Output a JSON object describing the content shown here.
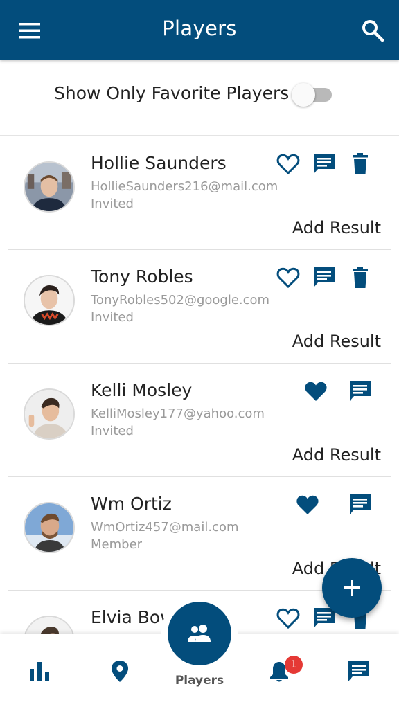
{
  "header": {
    "title": "Players",
    "menu_icon": "menu-icon",
    "search_icon": "search-icon",
    "color": "#034d7c"
  },
  "filter": {
    "label": "Show Only Favorite Players",
    "enabled": false
  },
  "players": [
    {
      "name": "Hollie Saunders",
      "email": "HollieSaunders216@mail.com",
      "status": "Invited",
      "favorite": false,
      "action": "Add Result"
    },
    {
      "name": "Tony Robles",
      "email": "TonyRobles502@google.com",
      "status": "Invited",
      "favorite": false,
      "action": "Add Result"
    },
    {
      "name": "Kelli Mosley",
      "email": "KelliMosley177@yahoo.com",
      "status": "Invited",
      "favorite": true,
      "action": "Add Result"
    },
    {
      "name": "Wm Ortiz",
      "email": "WmOrtiz457@mail.com",
      "status": "Member",
      "favorite": true,
      "action": "Add Result"
    },
    {
      "name": "Elvia Bow",
      "favorite": false
    }
  ],
  "bottom_nav": {
    "items": [
      "stats-icon",
      "location-icon",
      "players-icon",
      "notifications-icon",
      "messages-icon"
    ],
    "active_label": "Players",
    "notification_count": "1"
  },
  "fab": {
    "icon": "plus-icon"
  }
}
